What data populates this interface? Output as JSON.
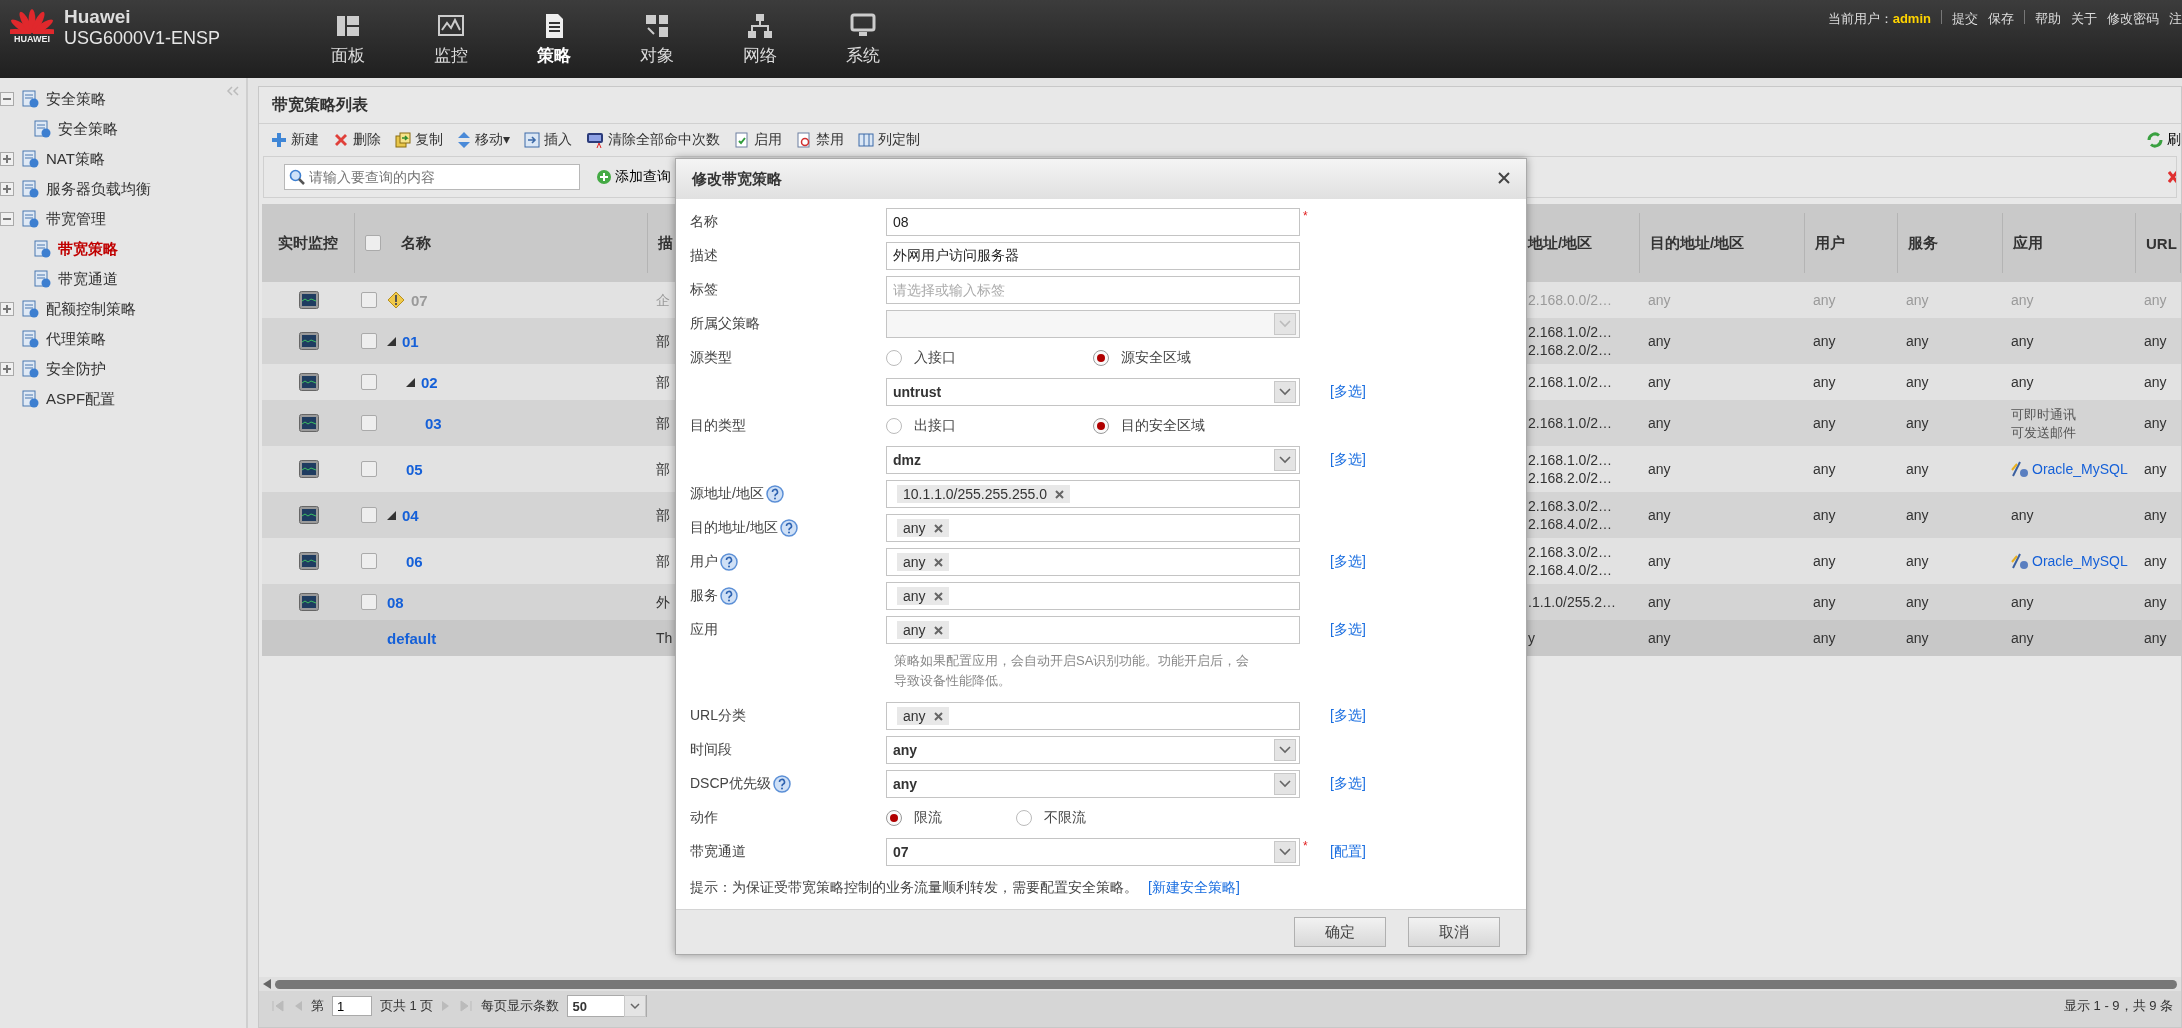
{
  "header": {
    "logo_text": "HUAWEI",
    "brand": "Huawei",
    "model": "USG6000V1-ENSP",
    "nav": [
      {
        "label": "面板",
        "selected": false
      },
      {
        "label": "监控",
        "selected": false
      },
      {
        "label": "策略",
        "selected": true
      },
      {
        "label": "对象",
        "selected": false
      },
      {
        "label": "网络",
        "selected": false
      },
      {
        "label": "系统",
        "selected": false
      }
    ],
    "user_label": "当前用户：",
    "user": "admin",
    "actions": [
      "提交",
      "保存"
    ],
    "links": [
      "帮助",
      "关于",
      "修改密码",
      "注"
    ]
  },
  "sidebar": {
    "items": [
      {
        "label": "安全策略",
        "kind": "group",
        "expanded": true,
        "selected": false,
        "children": [
          {
            "label": "安全策略",
            "kind": "leaf",
            "selected": false
          }
        ]
      },
      {
        "label": "NAT策略",
        "kind": "group",
        "expanded": false,
        "selected": false
      },
      {
        "label": "服务器负载均衡",
        "kind": "group",
        "expanded": false,
        "selected": false
      },
      {
        "label": "带宽管理",
        "kind": "group",
        "expanded": true,
        "selected": false,
        "children": [
          {
            "label": "带宽策略",
            "kind": "leaf",
            "selected": true
          },
          {
            "label": "带宽通道",
            "kind": "leaf",
            "selected": false
          }
        ]
      },
      {
        "label": "配额控制策略",
        "kind": "group",
        "expanded": false,
        "selected": false
      },
      {
        "label": "代理策略",
        "kind": "leaf",
        "selected": false
      },
      {
        "label": "安全防护",
        "kind": "group",
        "expanded": false,
        "selected": false
      },
      {
        "label": "ASPF配置",
        "kind": "leaf",
        "selected": false
      }
    ]
  },
  "panel": {
    "title": "带宽策略列表",
    "toolbar": [
      {
        "label": "新建",
        "kind": "add"
      },
      {
        "label": "删除",
        "kind": "delete"
      },
      {
        "label": "复制",
        "kind": "copy"
      },
      {
        "label": "移动▾",
        "kind": "move"
      },
      {
        "label": "插入",
        "kind": "insert"
      },
      {
        "label": "清除全部命中次数",
        "kind": "clear"
      },
      {
        "label": "启用",
        "kind": "enable"
      },
      {
        "label": "禁用",
        "kind": "disable"
      },
      {
        "label": "列定制",
        "kind": "columns"
      }
    ],
    "refresh": "刷",
    "search": {
      "placeholder": "请输入要查询的内容"
    },
    "add_query": "添加查询"
  },
  "table": {
    "header_checked": false,
    "columns": [
      "实时监控",
      "名称",
      "描",
      "地址/地区",
      "目的地址/地区",
      "用户",
      "服务",
      "应用",
      "URL"
    ],
    "rows": [
      {
        "name": "07",
        "kind": "policy",
        "disabled": true,
        "checked": false,
        "description": "企",
        "source_address": [
          "2.168.0.0/2…"
        ],
        "destination_address": "any",
        "user": "any",
        "service": "any",
        "application": {
          "kind": "text",
          "lines": [
            "any"
          ]
        },
        "url_category": "any"
      },
      {
        "name": "01",
        "kind": "policy",
        "disabled": false,
        "checked": false,
        "expanded": true,
        "description": "部",
        "source_address": [
          "2.168.1.0/2…",
          "2.168.2.0/2…"
        ],
        "destination_address": "any",
        "user": "any",
        "service": "any",
        "application": {
          "kind": "text",
          "lines": [
            "any"
          ]
        },
        "url_category": "any",
        "children": [
          {
            "name": "02",
            "kind": "policy",
            "disabled": false,
            "checked": false,
            "expanded": true,
            "description": "部",
            "source_address": [
              "2.168.1.0/2…"
            ],
            "destination_address": "any",
            "user": "any",
            "service": "any",
            "application": {
              "kind": "text",
              "lines": [
                "any"
              ]
            },
            "url_category": "any",
            "children": [
              {
                "name": "03",
                "kind": "policy",
                "disabled": false,
                "checked": false,
                "description": "部",
                "source_address": [
                  "2.168.1.0/2…"
                ],
                "destination_address": "any",
                "user": "any",
                "service": "any",
                "application": {
                  "kind": "text",
                  "lines": [
                    "可即时通讯",
                    "可发送邮件"
                  ]
                },
                "url_category": "any"
              }
            ]
          },
          {
            "name": "05",
            "kind": "policy",
            "disabled": false,
            "checked": false,
            "description": "部",
            "source_address": [
              "2.168.1.0/2…",
              "2.168.2.0/2…"
            ],
            "destination_address": "any",
            "user": "any",
            "service": "any",
            "application": {
              "kind": "link",
              "lines": [
                "Oracle_MySQL"
              ]
            },
            "url_category": "any"
          }
        ]
      },
      {
        "name": "04",
        "kind": "policy",
        "disabled": false,
        "checked": false,
        "expanded": true,
        "description": "部",
        "source_address": [
          "2.168.3.0/2…",
          "2.168.4.0/2…"
        ],
        "destination_address": "any",
        "user": "any",
        "service": "any",
        "application": {
          "kind": "text",
          "lines": [
            "any"
          ]
        },
        "url_category": "any",
        "children": [
          {
            "name": "06",
            "kind": "policy",
            "disabled": false,
            "checked": false,
            "description": "部",
            "source_address": [
              "2.168.3.0/2…",
              "2.168.4.0/2…"
            ],
            "destination_address": "any",
            "user": "any",
            "service": "any",
            "application": {
              "kind": "link",
              "lines": [
                "Oracle_MySQL"
              ]
            },
            "url_category": "any"
          }
        ]
      },
      {
        "name": "08",
        "kind": "policy",
        "disabled": false,
        "checked": false,
        "description": "外",
        "source_address": [
          ".1.1.0/255.2…"
        ],
        "destination_address": "any",
        "user": "any",
        "service": "any",
        "application": {
          "kind": "text",
          "lines": [
            "any"
          ]
        },
        "url_category": "any"
      },
      {
        "name": "default",
        "kind": "default",
        "disabled": false,
        "description": "Th",
        "source_address": [
          "y"
        ],
        "destination_address": "any",
        "user": "any",
        "service": "any",
        "application": {
          "kind": "text",
          "lines": [
            "any"
          ]
        },
        "url_category": "any"
      }
    ]
  },
  "pagination": {
    "page_label": "第",
    "page": "1",
    "page_total": "页共 1 页",
    "page_size_label": "每页显示条数",
    "page_size": "50",
    "summary": "显示 1 - 9，共 9 条"
  },
  "dialog": {
    "title": "修改带宽策略",
    "required_mark": "*",
    "fields": [
      {
        "kind": "input",
        "label": "名称",
        "value": "08",
        "required": true,
        "help": false
      },
      {
        "kind": "input",
        "label": "描述",
        "value": "外网用户访问服务器",
        "required": false,
        "help": false
      },
      {
        "kind": "input",
        "label": "标签",
        "placeholder": "请选择或输入标签",
        "required": false,
        "help": false
      },
      {
        "kind": "select",
        "label": "所属父策略",
        "disabled": true,
        "required": false,
        "help": false
      },
      {
        "kind": "radio",
        "label": "源类型",
        "options": [
          {
            "label": "入接口",
            "selected": false
          },
          {
            "label": "源安全区域",
            "selected": true
          }
        ]
      },
      {
        "kind": "select",
        "value": "untrust",
        "disabled": false,
        "required": false,
        "help": false,
        "link": "[多选]"
      },
      {
        "kind": "radio",
        "label": "目的类型",
        "options": [
          {
            "label": "出接口",
            "selected": false
          },
          {
            "label": "目的安全区域",
            "selected": true
          }
        ]
      },
      {
        "kind": "select",
        "value": "dmz",
        "disabled": false,
        "required": false,
        "help": false,
        "link": "[多选]"
      },
      {
        "kind": "tags",
        "label": "源地址/地区",
        "tags": [
          "10.1.1.0/255.255.255.0"
        ],
        "required": false,
        "help": true
      },
      {
        "kind": "tags",
        "label": "目的地址/地区",
        "tags": [
          "any"
        ],
        "required": false,
        "help": true
      },
      {
        "kind": "tags",
        "label": "用户",
        "tags": [
          "any"
        ],
        "required": false,
        "help": true,
        "link": "[多选]"
      },
      {
        "kind": "tags",
        "label": "服务",
        "tags": [
          "any"
        ],
        "required": false,
        "help": true
      },
      {
        "kind": "tags",
        "label": "应用",
        "tags": [
          "any"
        ],
        "required": false,
        "help": false,
        "link": "[多选]"
      },
      {
        "kind": "note",
        "text": "策略如果配置应用，会自动开启SA识别功能。功能开启后，会导致设备性能降低。"
      },
      {
        "kind": "tags",
        "label": "URL分类",
        "tags": [
          "any"
        ],
        "required": false,
        "help": false,
        "link": "[多选]"
      },
      {
        "kind": "select",
        "label": "时间段",
        "value": "any",
        "disabled": false,
        "required": false,
        "help": false
      },
      {
        "kind": "select",
        "label": "DSCP优先级",
        "value": "any",
        "disabled": false,
        "required": false,
        "help": true,
        "link": "[多选]"
      },
      {
        "kind": "radio",
        "label": "动作",
        "options": [
          {
            "label": "限流",
            "selected": true
          },
          {
            "label": "不限流",
            "selected": false
          }
        ]
      },
      {
        "kind": "select",
        "label": "带宽通道",
        "value": "07",
        "disabled": false,
        "required": true,
        "help": false,
        "link": "[配置]"
      }
    ],
    "hint": "提示：为保证受带宽策略控制的业务流量顺利转发，需要配置安全策略。",
    "hint_link": "[新建安全策略]",
    "buttons": [
      "确定",
      "取消"
    ]
  }
}
